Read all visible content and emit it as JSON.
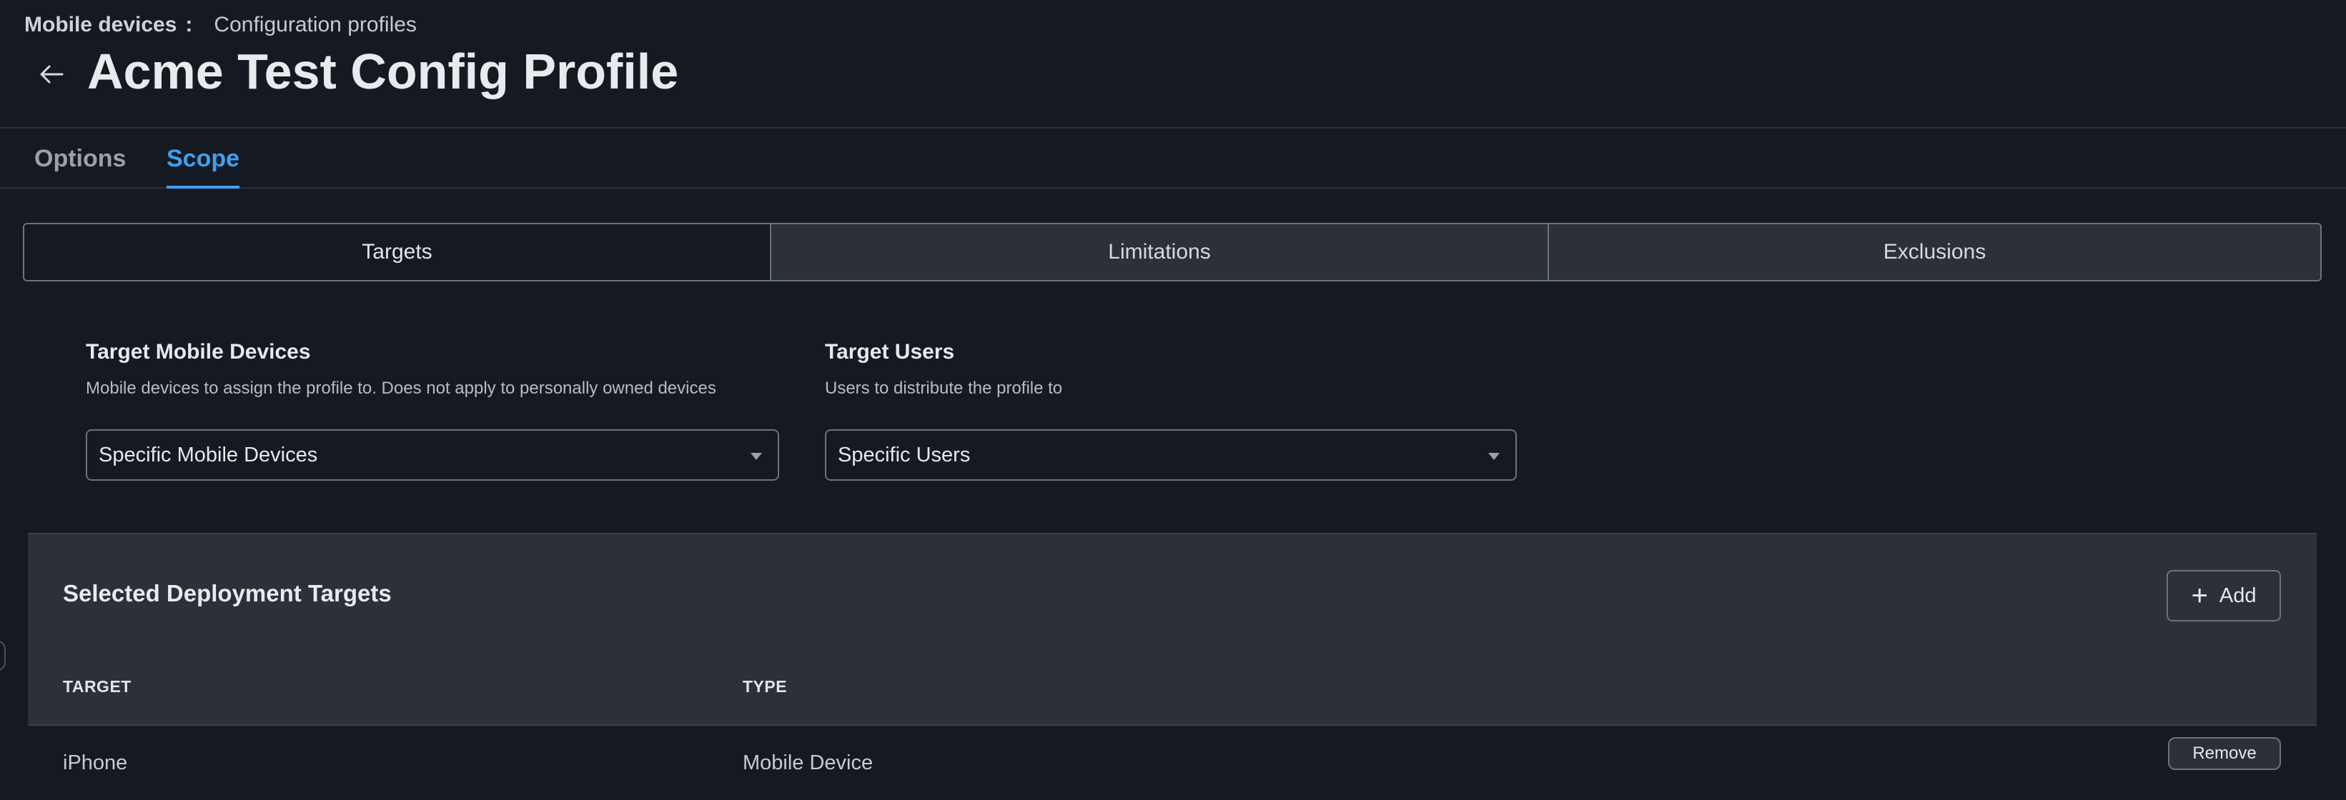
{
  "breadcrumb": {
    "root": "Mobile devices",
    "separator": ":",
    "current": "Configuration profiles"
  },
  "page": {
    "title": "Acme Test Config Profile",
    "back_icon": "arrow-left-icon"
  },
  "tabs": [
    {
      "label": "Options",
      "active": false
    },
    {
      "label": "Scope",
      "active": true
    }
  ],
  "scope_segments": [
    {
      "label": "Targets",
      "selected": true
    },
    {
      "label": "Limitations",
      "selected": false
    },
    {
      "label": "Exclusions",
      "selected": false
    }
  ],
  "target_mobile_devices": {
    "label": "Target Mobile Devices",
    "help": "Mobile devices to assign the profile to. Does not apply to personally owned devices",
    "value": "Specific Mobile Devices"
  },
  "target_users": {
    "label": "Target Users",
    "help": "Users to distribute the profile to",
    "value": "Specific Users"
  },
  "deployment_targets": {
    "title": "Selected Deployment Targets",
    "add_label": "Add",
    "columns": [
      "TARGET",
      "TYPE"
    ],
    "rows": [
      {
        "target": "iPhone",
        "type": "Mobile Device",
        "action": "Remove"
      }
    ]
  },
  "colors": {
    "background": "#151a22",
    "accent": "#3fa0f0",
    "panel": "#2b3039"
  }
}
